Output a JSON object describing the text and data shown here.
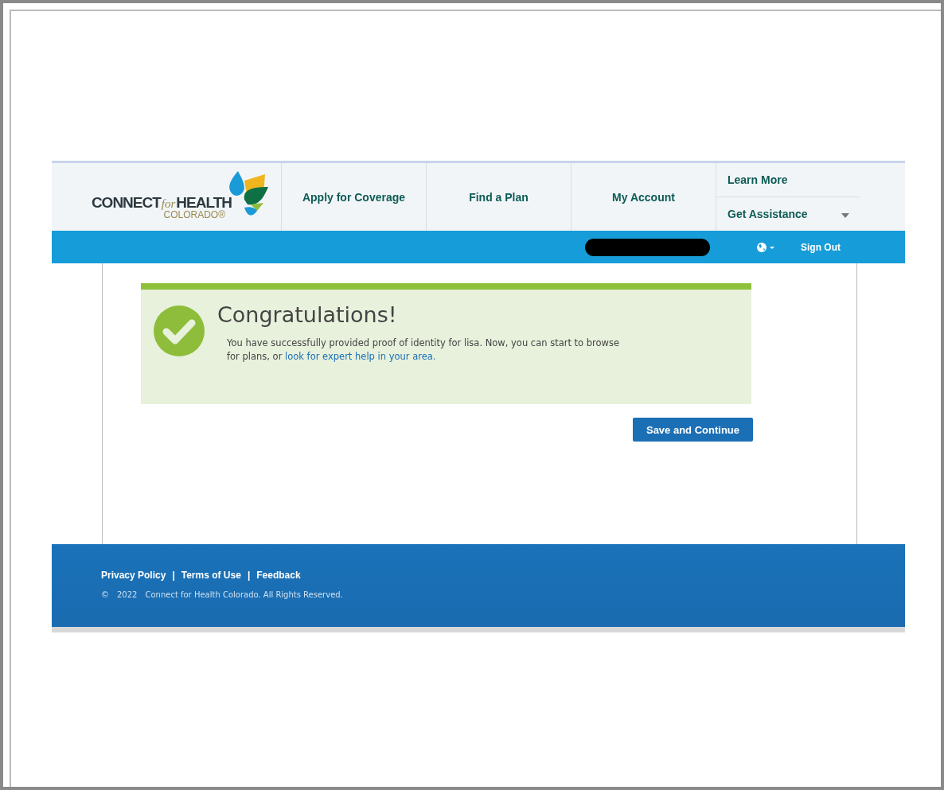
{
  "logo": {
    "word_1": "CONNECT",
    "word_2": "for",
    "word_3": "HEALTH",
    "word_4": "COLORADO®"
  },
  "nav": [
    {
      "label": "Apply for Coverage"
    },
    {
      "label": "Find a Plan"
    },
    {
      "label": "My Account"
    }
  ],
  "nav_right": [
    {
      "label": "Learn More",
      "has_caret": false
    },
    {
      "label": "Get Assistance",
      "has_caret": true
    }
  ],
  "top_bar": {
    "sign_out": "Sign Out"
  },
  "alert": {
    "title": "Congratulations!",
    "message": "You have successfully provided proof of identity for lisa. Now, you can start to browse for plans, or ",
    "link": "look for expert help in your area."
  },
  "buttons": [
    {
      "label": "Save and Continue"
    }
  ],
  "footer": {
    "links": [
      "Privacy Policy",
      "Terms of Use",
      "Feedback"
    ],
    "separator": "|",
    "copyright_symbol": "©",
    "year": "2022",
    "copyright": "Connect for Health Colorado. All Rights Reserved."
  }
}
